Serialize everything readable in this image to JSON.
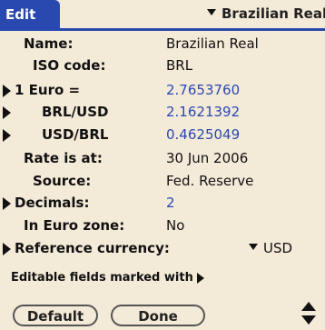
{
  "title": "Edit",
  "currency_selector": "Brazilian Real",
  "fields": {
    "name": {
      "label": "Name:",
      "value": "Brazilian Real"
    },
    "iso": {
      "label": "ISO code:",
      "value": "BRL"
    },
    "euro": {
      "label": "1 Euro =",
      "value": "2.7653760"
    },
    "brl_usd": {
      "label": "BRL/USD",
      "value": "2.1621392"
    },
    "usd_brl": {
      "label": "USD/BRL",
      "value": "0.4625049"
    },
    "rate_at": {
      "label": "Rate is at:",
      "value": "30 Jun 2006"
    },
    "source": {
      "label": "Source:",
      "value": "Fed. Reserve"
    },
    "decimals": {
      "label": "Decimals:",
      "value": "2"
    },
    "euro_zone": {
      "label": "In Euro zone:",
      "value": "No"
    },
    "reference": {
      "label": "Reference currency:",
      "value": "USD"
    }
  },
  "footnote": "Editable fields marked with",
  "buttons": {
    "default": "Default",
    "done": "Done"
  },
  "colors": {
    "accent": "#2a49b0",
    "background": "#f4ead8"
  }
}
